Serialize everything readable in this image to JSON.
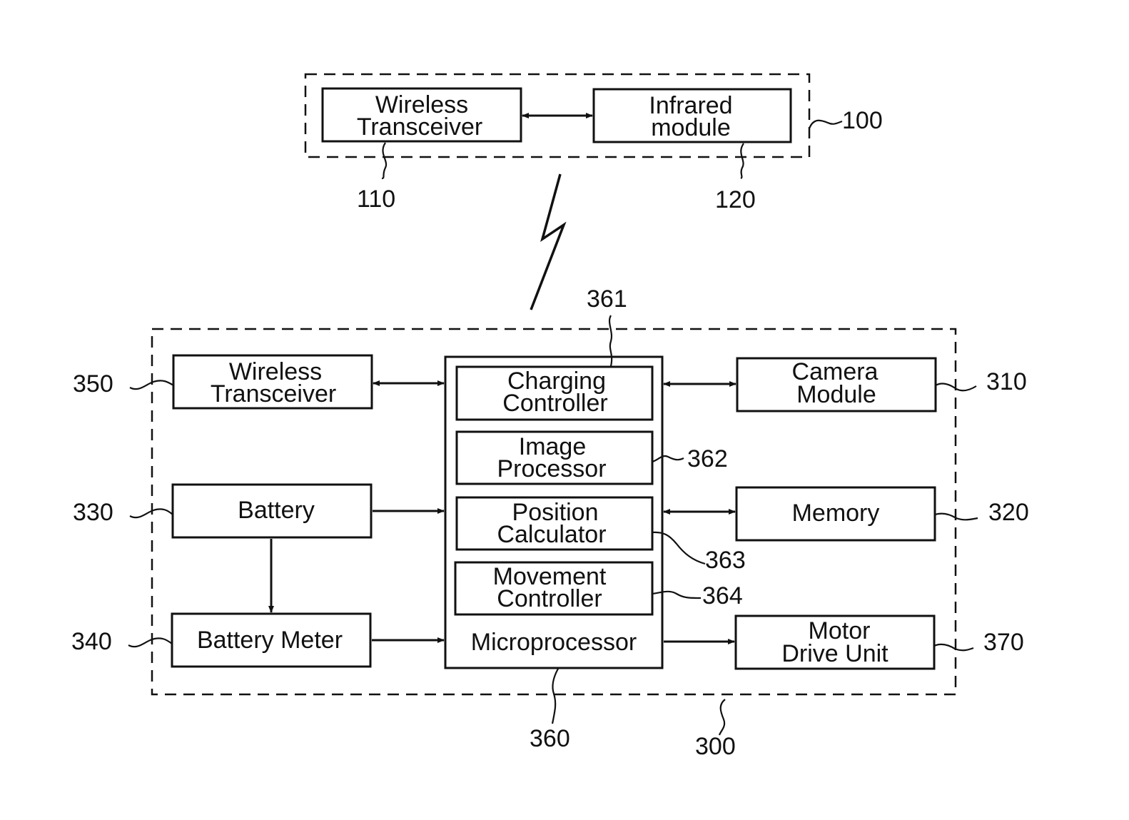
{
  "diagram": {
    "remote_unit": {
      "ref": "100",
      "blocks": [
        {
          "id": "wireless_transceiver_110",
          "lines": [
            "Wireless",
            "Transceiver"
          ],
          "ref": "110"
        },
        {
          "id": "infrared_module_120",
          "lines": [
            "Infrared",
            "module"
          ],
          "ref": "120"
        }
      ]
    },
    "robot_unit": {
      "ref": "300",
      "left_blocks": [
        {
          "id": "wireless_transceiver_350",
          "lines": [
            "Wireless",
            "Transceiver"
          ],
          "ref": "350"
        },
        {
          "id": "battery_330",
          "lines": [
            "Battery"
          ],
          "ref": "330"
        },
        {
          "id": "battery_meter_340",
          "lines": [
            "Battery Meter"
          ],
          "ref": "340"
        }
      ],
      "microprocessor": {
        "label": "Microprocessor",
        "ref": "360",
        "sub_blocks": [
          {
            "id": "charging_controller_361",
            "lines": [
              "Charging",
              "Controller"
            ],
            "ref": "361"
          },
          {
            "id": "image_processor_362",
            "lines": [
              "Image",
              "Processor"
            ],
            "ref": "362"
          },
          {
            "id": "position_calculator_363",
            "lines": [
              "Position",
              "Calculator"
            ],
            "ref": "363"
          },
          {
            "id": "movement_controller_364",
            "lines": [
              "Movement",
              "Controller"
            ],
            "ref": "364"
          }
        ]
      },
      "right_blocks": [
        {
          "id": "camera_module_310",
          "lines": [
            "Camera",
            "Module"
          ],
          "ref": "310"
        },
        {
          "id": "memory_320",
          "lines": [
            "Memory"
          ],
          "ref": "320"
        },
        {
          "id": "motor_drive_unit_370",
          "lines": [
            "Motor",
            "Drive Unit"
          ],
          "ref": "370"
        }
      ]
    },
    "connections": [
      {
        "from": "Wireless Transceiver (110)",
        "to": "Infrared module (120)",
        "type": "bidirectional"
      },
      {
        "from": "Remote unit (100)",
        "to": "Robot unit (300)",
        "type": "wireless-link"
      },
      {
        "from": "Wireless Transceiver (350)",
        "to": "Microprocessor (360)",
        "type": "bidirectional"
      },
      {
        "from": "Battery (330)",
        "to": "Microprocessor (360)",
        "type": "directed"
      },
      {
        "from": "Battery (330)",
        "to": "Battery Meter (340)",
        "type": "directed"
      },
      {
        "from": "Battery Meter (340)",
        "to": "Microprocessor (360)",
        "type": "directed"
      },
      {
        "from": "Microprocessor (360)",
        "to": "Camera Module (310)",
        "type": "bidirectional"
      },
      {
        "from": "Microprocessor (360)",
        "to": "Memory (320)",
        "type": "bidirectional"
      },
      {
        "from": "Microprocessor (360)",
        "to": "Motor Drive Unit (370)",
        "type": "directed"
      }
    ],
    "icons": {
      "wireless_link": "lightning-bolt-icon"
    }
  }
}
